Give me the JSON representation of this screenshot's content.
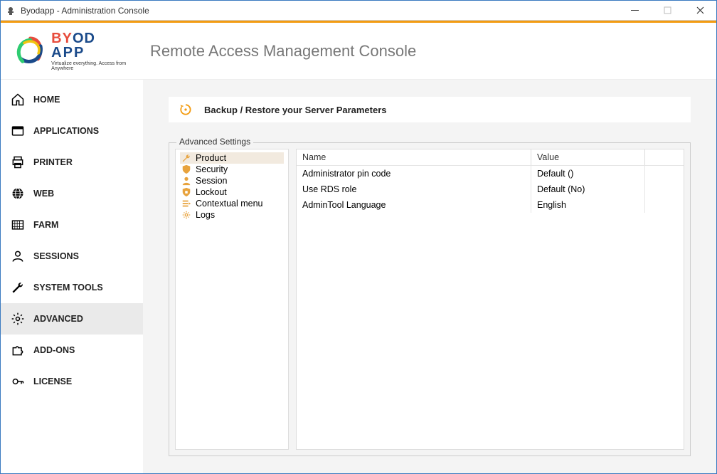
{
  "window": {
    "title": "Byodapp - Administration Console"
  },
  "header": {
    "brand_top_left": "BY",
    "brand_top_right": "OD",
    "brand_bottom": "APP",
    "tagline": "Virtualize everything. Access from Anywhere",
    "console_title": "Remote Access Management Console"
  },
  "sidebar": {
    "items": [
      {
        "id": "home",
        "label": "HOME"
      },
      {
        "id": "applications",
        "label": "APPLICATIONS"
      },
      {
        "id": "printer",
        "label": "PRINTER"
      },
      {
        "id": "web",
        "label": "WEB"
      },
      {
        "id": "farm",
        "label": "FARM"
      },
      {
        "id": "sessions",
        "label": "SESSIONS"
      },
      {
        "id": "systemtools",
        "label": "SYSTEM TOOLS"
      },
      {
        "id": "advanced",
        "label": "ADVANCED"
      },
      {
        "id": "addons",
        "label": "ADD-ONS"
      },
      {
        "id": "license",
        "label": "LICENSE"
      }
    ],
    "active": "advanced"
  },
  "content": {
    "backup_label": "Backup / Restore your Server Parameters",
    "fieldset_title": "Advanced Settings",
    "categories": [
      {
        "id": "product",
        "label": "Product"
      },
      {
        "id": "security",
        "label": "Security"
      },
      {
        "id": "session",
        "label": "Session"
      },
      {
        "id": "lockout",
        "label": "Lockout"
      },
      {
        "id": "ctxmenu",
        "label": "Contextual menu"
      },
      {
        "id": "logs",
        "label": "Logs"
      }
    ],
    "category_active": "product",
    "table": {
      "headers": {
        "name": "Name",
        "value": "Value"
      },
      "rows": [
        {
          "name": "Administrator pin code",
          "value": "Default ()"
        },
        {
          "name": "Use RDS role",
          "value": "Default (No)"
        },
        {
          "name": "AdminTool Language",
          "value": "English"
        }
      ]
    }
  }
}
